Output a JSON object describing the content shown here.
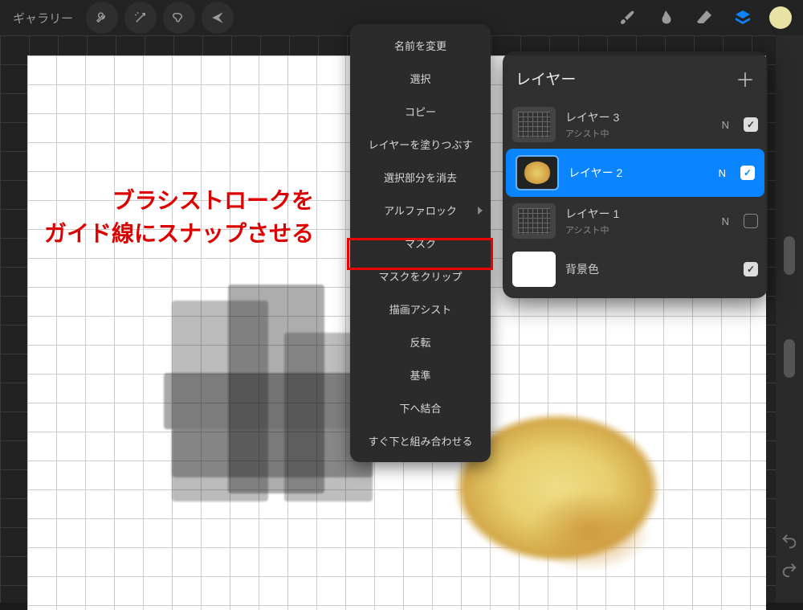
{
  "toolbar": {
    "gallery_label": "ギャラリー"
  },
  "annotation": {
    "line1": "ブラシストロークを",
    "line2": "ガイド線にスナップさせる"
  },
  "context_menu": {
    "items": [
      "名前を変更",
      "選択",
      "コピー",
      "レイヤーを塗りつぶす",
      "選択部分を消去",
      "アルファロック",
      "マスク",
      "マスクをクリップ",
      "描画アシスト",
      "反転",
      "基準",
      "下へ結合",
      "すぐ下と組み合わせる"
    ],
    "submenu_index": 5,
    "highlighted_index": 8
  },
  "layers_panel": {
    "title": "レイヤー",
    "rows": [
      {
        "name": "レイヤー 3",
        "assist": "アシスト中",
        "blend": "N",
        "checked": true,
        "selected": false,
        "thumb": "grid"
      },
      {
        "name": "レイヤー 2",
        "assist": "",
        "blend": "N",
        "checked": true,
        "selected": true,
        "thumb": "blob"
      },
      {
        "name": "レイヤー 1",
        "assist": "アシスト中",
        "blend": "N",
        "checked": false,
        "selected": false,
        "thumb": "grid"
      },
      {
        "name": "背景色",
        "assist": "",
        "blend": "",
        "checked": true,
        "selected": false,
        "thumb": "bg"
      }
    ]
  },
  "colors": {
    "accent": "#0a84ff",
    "swatch": "#e9e2a5",
    "annotation": "#d00000"
  }
}
